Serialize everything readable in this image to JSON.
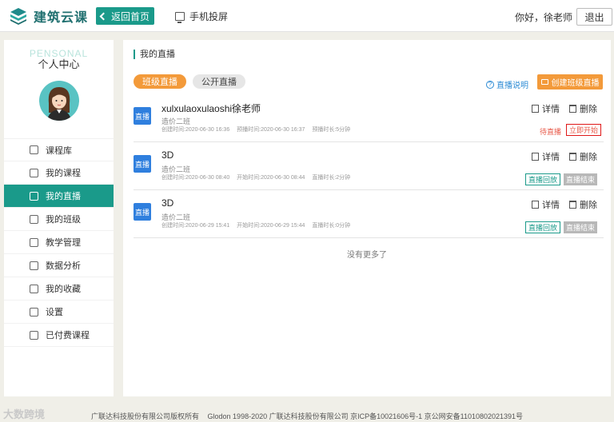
{
  "header": {
    "logo_text": "建筑云课",
    "back_label": "返回首页",
    "cast_label": "手机投屏",
    "greeting": "你好，徐老师",
    "logout_label": "退出"
  },
  "sidebar": {
    "title_en": "PENSONAL",
    "title_cn": "个人中心",
    "items": [
      {
        "label": "课程库",
        "icon": "cube-icon"
      },
      {
        "label": "我的课程",
        "icon": "course-icon"
      },
      {
        "label": "我的直播",
        "icon": "live-icon",
        "active": true
      },
      {
        "label": "我的班级",
        "icon": "class-icon"
      },
      {
        "label": "教学管理",
        "icon": "manage-icon"
      },
      {
        "label": "数据分析",
        "icon": "chart-icon"
      },
      {
        "label": "我的收藏",
        "icon": "star-icon"
      },
      {
        "label": "设置",
        "icon": "gear-icon"
      },
      {
        "label": "已付费课程",
        "icon": "paid-icon"
      }
    ]
  },
  "main": {
    "section_title": "我的直播",
    "tabs": [
      "班级直播",
      "公开直播"
    ],
    "help_label": "直播说明",
    "create_label": "创建班级直播",
    "detail_label": "详情",
    "delete_label": "删除",
    "badge_label": "直播",
    "items": [
      {
        "title": "xulxulaoxulaoshi徐老师",
        "class": "造价二班",
        "meta": [
          "创建时间:2020-06-30 16:36",
          "预播时间:2020-06-30 16:37",
          "预播时长:5分钟"
        ],
        "status": "待直播",
        "action": "立即开始"
      },
      {
        "title": "3D",
        "class": "造价二班",
        "meta": [
          "创建时间:2020-06-30 08:40",
          "开始时间:2020-06-30 08:44",
          "直播时长:2分钟"
        ],
        "replay": "直播回放",
        "ended": "直播结束"
      },
      {
        "title": "3D",
        "class": "造价二班",
        "meta": [
          "创建时间:2020-06-29 15:41",
          "开始时间:2020-06-29 15:44",
          "直播时长:0分钟"
        ],
        "replay": "直播回放",
        "ended": "直播结束"
      }
    ],
    "no_more": "没有更多了"
  },
  "footer": {
    "watermark": "大数跨境",
    "copyright": [
      "广联达科技股份有限公司版权所有",
      "Glodon 1998-2020 广联达科技股份有限公司 京ICP备10021606号-1 京公网安备11010802021391号"
    ]
  },
  "colors": {
    "accent": "#1a9a8a",
    "orange": "#f39a3a",
    "badge_blue": "#2f7fde",
    "danger": "#e01818"
  }
}
